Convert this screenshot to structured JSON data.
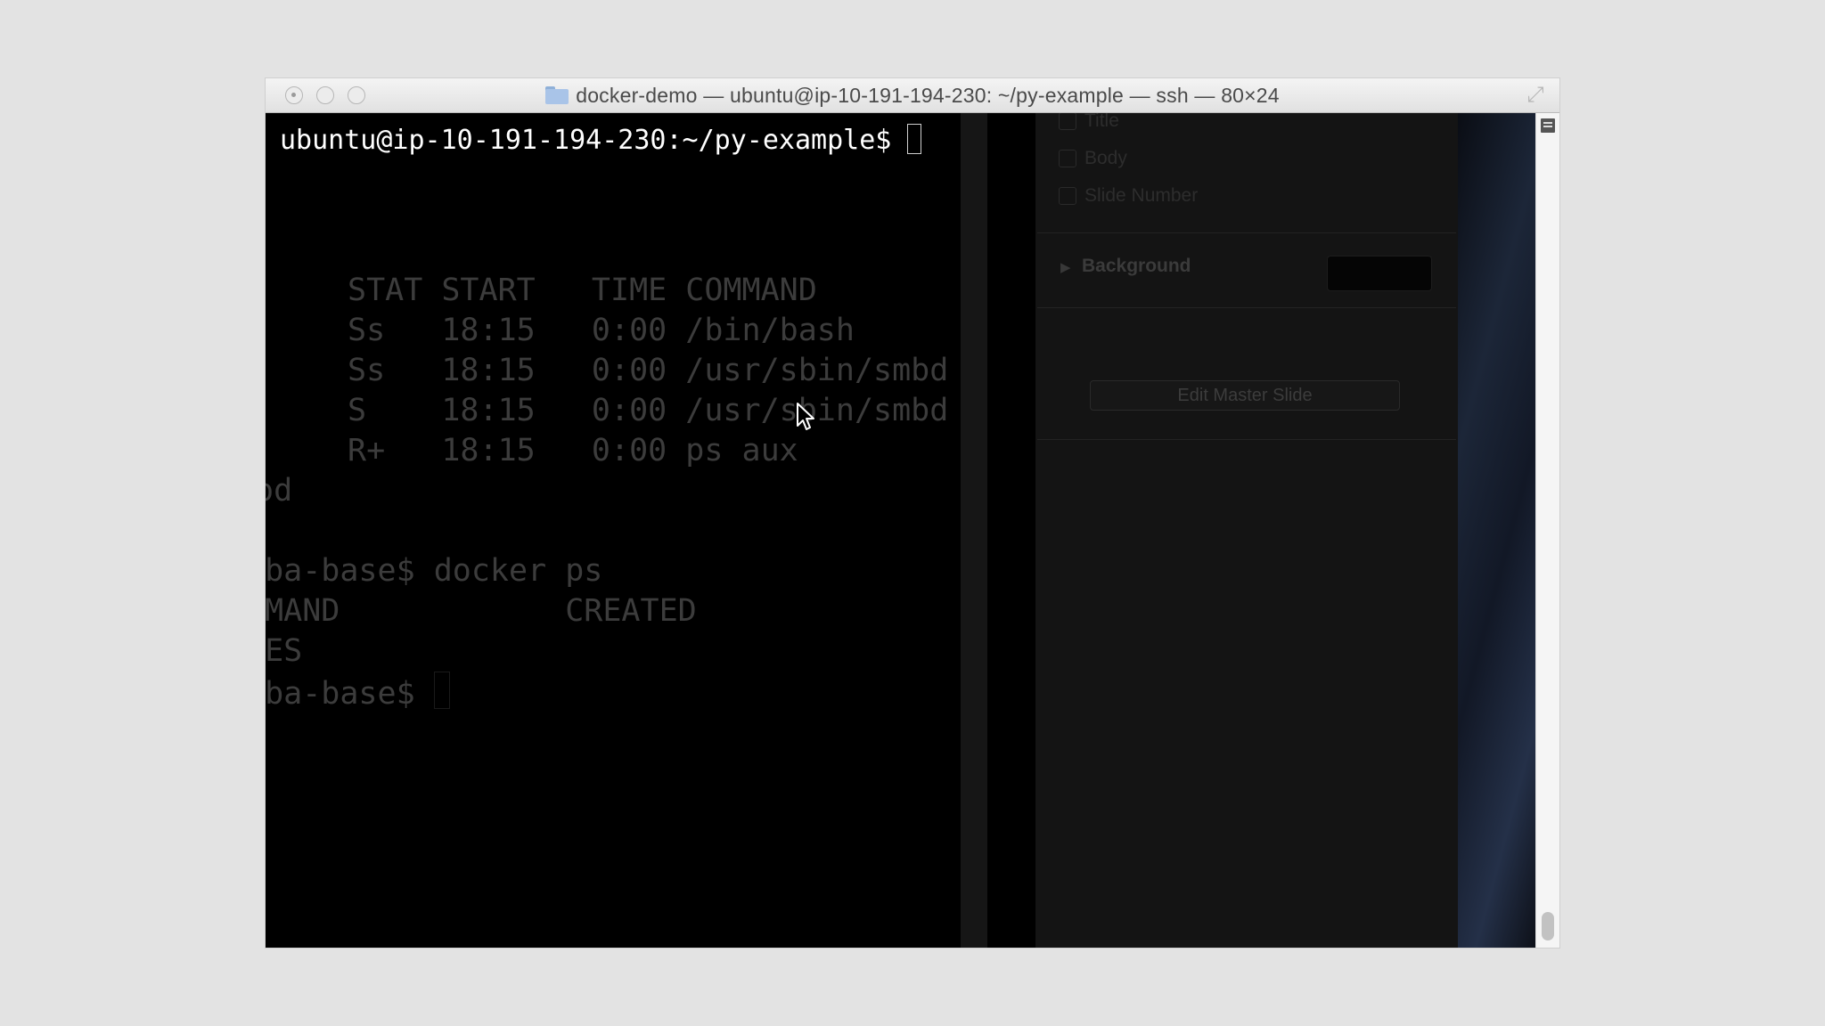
{
  "window": {
    "title": "docker-demo — ubuntu@ip-10-191-194-230: ~/py-example — ssh — 80×24"
  },
  "terminal": {
    "prompt": "ubuntu@ip-10-191-194-230:~/py-example$ "
  },
  "faded_terminal": {
    "ps_header": "STAT START   TIME COMMAND",
    "ps_rows": [
      "Ss   18:15   0:00 /bin/bash",
      "Ss   18:15   0:00 /usr/sbin/smbd",
      "S    18:15   0:00 /usr/sbin/smbd",
      "R+   18:15   0:00 ps aux"
    ],
    "fragment_od": "od",
    "docker_cmd": "mba-base$ docker ps",
    "docker_header": "MMAND            CREATED",
    "fragment_mes": "MES",
    "last_prompt": "mba-base$ "
  },
  "ghost_panel": {
    "checkboxes": [
      "Title",
      "Body",
      "Slide Number"
    ],
    "background_label": "Background",
    "edit_master_label": "Edit Master Slide"
  },
  "icons": {
    "window_close": "close-icon",
    "window_minimize": "minimize-icon",
    "window_zoom": "zoom-icon",
    "folder": "folder-icon",
    "fullscreen": "fullscreen-icon",
    "scroll_menu": "menu-icon",
    "pointer": "mouse-pointer-icon"
  }
}
